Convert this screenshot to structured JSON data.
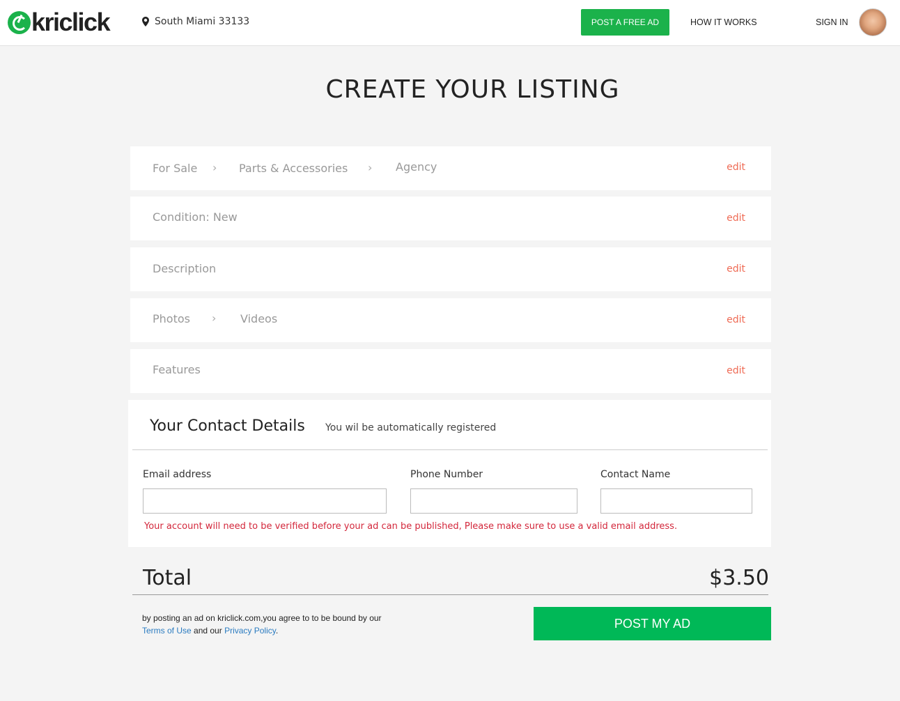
{
  "header": {
    "logo_text": "kriclick",
    "location": "South Miami 33133",
    "post_free_ad": "POST A FREE AD",
    "how_it_works": "HOW IT WORKS",
    "sign_in": "SIGN IN"
  },
  "page_title": "CREATE YOUR LISTING",
  "steps": {
    "category": {
      "items": [
        "For Sale",
        "Parts & Accessories",
        "Agency"
      ],
      "separator": "›",
      "edit": "edit"
    },
    "condition": {
      "label": "Condition: New",
      "edit": "edit"
    },
    "description": {
      "label": "Description",
      "edit": "edit"
    },
    "media": {
      "items": [
        "Photos",
        "Videos"
      ],
      "separator": "›",
      "edit": "edit"
    },
    "features": {
      "label": "Features",
      "edit": "edit"
    }
  },
  "contact": {
    "title": "Your Contact Details",
    "subtitle": "You wil be automatically registered",
    "email_label": "Email address",
    "email_value": "",
    "phone_label": "Phone Number",
    "phone_value": "",
    "name_label": "Contact Name",
    "name_value": "",
    "warning": "Your account will need to be verified before your ad can be published, Please make sure to use a valid email address."
  },
  "total": {
    "label": "Total",
    "value": "$3.50"
  },
  "terms": {
    "text_before": "by posting an ad on kriclick.com,you agree to to be bound by our",
    "terms_link": "Terms of Use",
    "and_our": " and our ",
    "privacy_link": "Privacy Policy",
    "end": "."
  },
  "post_button": "POST MY AD",
  "colors": {
    "brand_green": "#1bb24b",
    "edit_red": "#ef6b55",
    "warning_red": "#d3273b",
    "link_blue": "#2a7bc0"
  }
}
